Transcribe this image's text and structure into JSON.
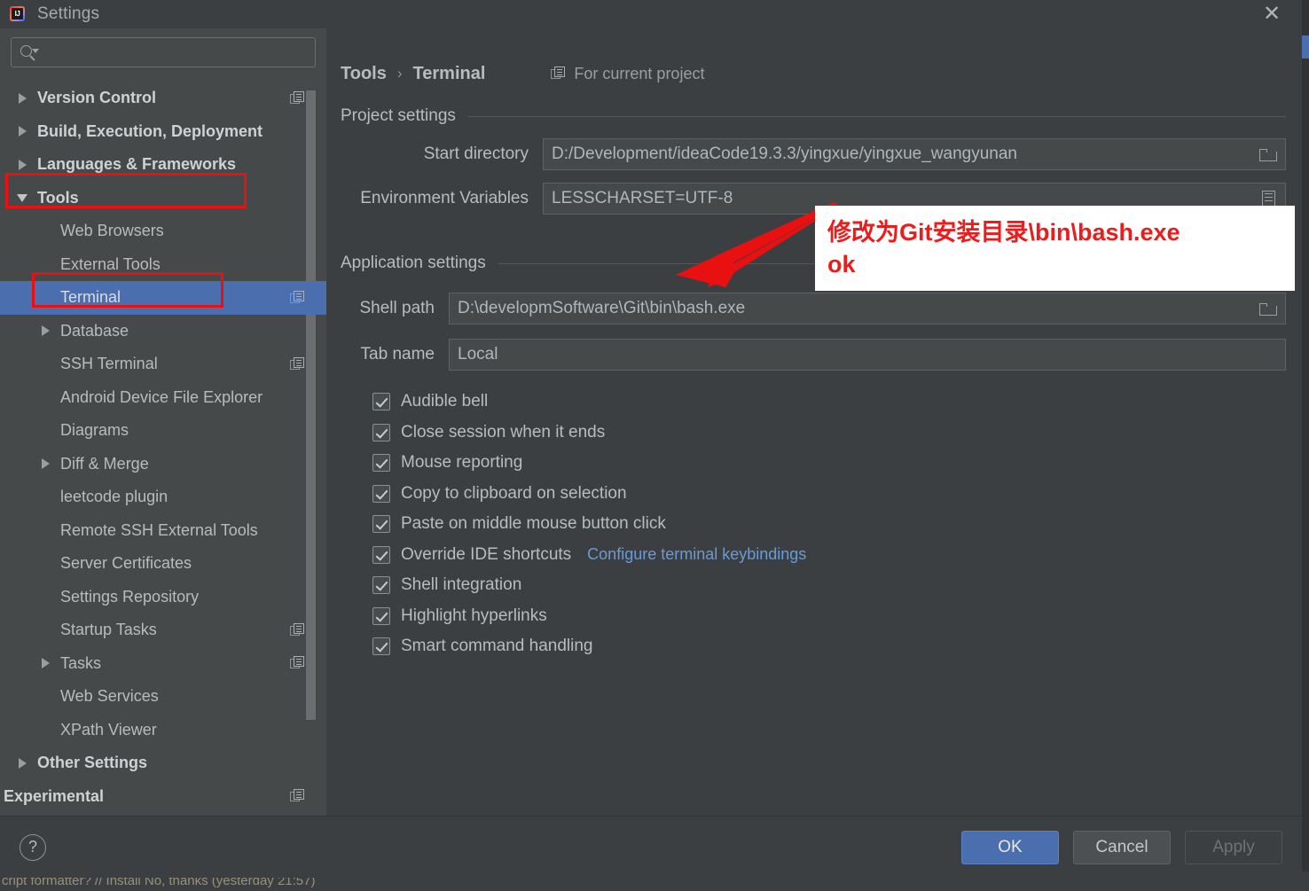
{
  "window": {
    "title": "Settings",
    "app_icon": "intellij-idea-icon",
    "close_label": "✕"
  },
  "backdrop": {
    "status_text": "cript formatter? // Install  No, thanks (yesterday 21:57)"
  },
  "search": {
    "value": "",
    "placeholder": "",
    "icon": "search-icon"
  },
  "sidebar": {
    "items": [
      {
        "label": "Version Control",
        "level": 0,
        "bold": true,
        "twisty": "right",
        "cfg": true,
        "selected": false
      },
      {
        "label": "Build, Execution, Deployment",
        "level": 0,
        "bold": true,
        "twisty": "right",
        "cfg": false,
        "selected": false
      },
      {
        "label": "Languages & Frameworks",
        "level": 0,
        "bold": true,
        "twisty": "right",
        "cfg": false,
        "selected": false
      },
      {
        "label": "Tools",
        "level": 0,
        "bold": true,
        "twisty": "down",
        "cfg": false,
        "selected": false
      },
      {
        "label": "Web Browsers",
        "level": 1,
        "bold": false,
        "twisty": "none",
        "cfg": false,
        "selected": false
      },
      {
        "label": "External Tools",
        "level": 1,
        "bold": false,
        "twisty": "none",
        "cfg": false,
        "selected": false
      },
      {
        "label": "Terminal",
        "level": 1,
        "bold": false,
        "twisty": "none",
        "cfg": true,
        "selected": true
      },
      {
        "label": "Database",
        "level": 1,
        "bold": false,
        "twisty": "right",
        "cfg": false,
        "selected": false
      },
      {
        "label": "SSH Terminal",
        "level": 1,
        "bold": false,
        "twisty": "none",
        "cfg": true,
        "selected": false
      },
      {
        "label": "Android Device File Explorer",
        "level": 1,
        "bold": false,
        "twisty": "none",
        "cfg": false,
        "selected": false
      },
      {
        "label": "Diagrams",
        "level": 1,
        "bold": false,
        "twisty": "none",
        "cfg": false,
        "selected": false
      },
      {
        "label": "Diff & Merge",
        "level": 1,
        "bold": false,
        "twisty": "right",
        "cfg": false,
        "selected": false
      },
      {
        "label": "leetcode plugin",
        "level": 1,
        "bold": false,
        "twisty": "none",
        "cfg": false,
        "selected": false
      },
      {
        "label": "Remote SSH External Tools",
        "level": 1,
        "bold": false,
        "twisty": "none",
        "cfg": false,
        "selected": false
      },
      {
        "label": "Server Certificates",
        "level": 1,
        "bold": false,
        "twisty": "none",
        "cfg": false,
        "selected": false
      },
      {
        "label": "Settings Repository",
        "level": 1,
        "bold": false,
        "twisty": "none",
        "cfg": false,
        "selected": false
      },
      {
        "label": "Startup Tasks",
        "level": 1,
        "bold": false,
        "twisty": "none",
        "cfg": true,
        "selected": false
      },
      {
        "label": "Tasks",
        "level": 1,
        "bold": false,
        "twisty": "right",
        "cfg": true,
        "selected": false
      },
      {
        "label": "Web Services",
        "level": 1,
        "bold": false,
        "twisty": "none",
        "cfg": false,
        "selected": false
      },
      {
        "label": "XPath Viewer",
        "level": 1,
        "bold": false,
        "twisty": "none",
        "cfg": false,
        "selected": false
      },
      {
        "label": "Other Settings",
        "level": 0,
        "bold": true,
        "twisty": "right",
        "cfg": false,
        "selected": false
      },
      {
        "label": "Experimental",
        "level": 0,
        "bold": true,
        "twisty": "none",
        "cfg": true,
        "selected": false
      }
    ]
  },
  "main": {
    "breadcrumb": {
      "parent": "Tools",
      "separator": "›",
      "current": "Terminal"
    },
    "for_current_project": "For current project",
    "project_settings": {
      "section_title": "Project settings",
      "start_directory": {
        "label": "Start directory",
        "value": "D:/Development/ideaCode19.3.3/yingxue/yingxue_wangyunan",
        "button_icon": "folder-icon"
      },
      "environment_variables": {
        "label": "Environment Variables",
        "value": "LESSCHARSET=UTF-8",
        "button_icon": "list-edit-icon"
      }
    },
    "application_settings": {
      "section_title": "Application settings",
      "shell_path": {
        "label": "Shell path",
        "value": "D:\\developmSoftware\\Git\\bin\\bash.exe",
        "button_icon": "folder-icon"
      },
      "tab_name": {
        "label": "Tab name",
        "value": "Local"
      },
      "checkboxes": [
        {
          "label": "Audible bell",
          "checked": true
        },
        {
          "label": "Close session when it ends",
          "checked": true
        },
        {
          "label": "Mouse reporting",
          "checked": true
        },
        {
          "label": "Copy to clipboard on selection",
          "checked": true
        },
        {
          "label": "Paste on middle mouse button click",
          "checked": true
        },
        {
          "label": "Override IDE shortcuts",
          "checked": true,
          "link": "Configure terminal keybindings"
        },
        {
          "label": "Shell integration",
          "checked": true
        },
        {
          "label": "Highlight hyperlinks",
          "checked": true
        },
        {
          "label": "Smart command handling",
          "checked": true
        }
      ]
    }
  },
  "annotation": {
    "line1": "修改为Git安装目录\\bin\\bash.exe",
    "line2": "ok",
    "color": "#ed1c1c"
  },
  "footer": {
    "help_label": "?",
    "ok_label": "OK",
    "cancel_label": "Cancel",
    "apply_label": "Apply"
  },
  "colors": {
    "dialog_bg": "#3c3f41",
    "sidebar_bg": "#45494a",
    "selection_blue": "#4b6eaf",
    "link_blue": "#6b9bd2",
    "annotation_red": "#ed1c1c",
    "text": "#b9bcbe"
  }
}
